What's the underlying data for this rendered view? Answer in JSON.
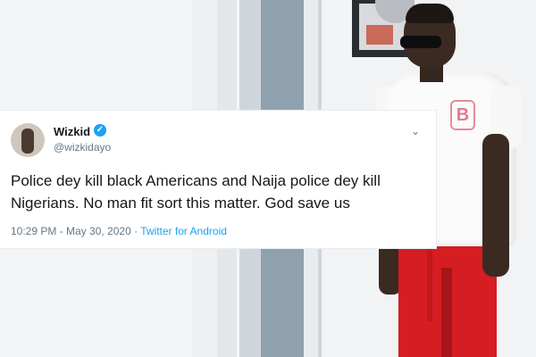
{
  "tweet": {
    "author_name": "Wizkid",
    "author_handle": "@wizkidayo",
    "text": "Police dey kill black Americans and Naija police dey kill Nigerians. No man fit sort this matter. God save us",
    "time": "10:29 PM - May 30, 2020 ·",
    "source": "Twitter for Android",
    "verified_icon": "verified-badge-icon",
    "menu_icon": "chevron-down-icon"
  },
  "colors": {
    "twitter_blue": "#1da1f2",
    "text_primary": "#14171a",
    "text_secondary": "#657786"
  }
}
